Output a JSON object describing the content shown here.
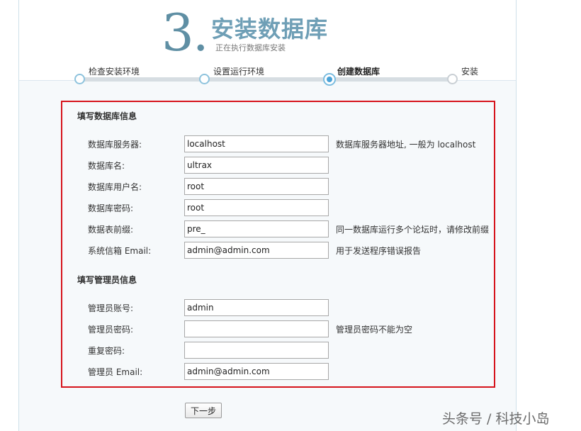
{
  "header": {
    "step_number": "3.",
    "title": "安装数据库",
    "subtitle": "正在执行数据库安装"
  },
  "progress": {
    "steps": [
      {
        "label": "检查安装环境",
        "state": "done"
      },
      {
        "label": "设置运行环境",
        "state": "done"
      },
      {
        "label": "创建数据库",
        "state": "current"
      },
      {
        "label": "安装",
        "state": "todo"
      }
    ]
  },
  "db_section": {
    "title": "填写数据库信息",
    "fields": [
      {
        "label": "数据库服务器:",
        "value": "localhost",
        "hint": "数据库服务器地址, 一般为 localhost"
      },
      {
        "label": "数据库名:",
        "value": "ultrax",
        "hint": ""
      },
      {
        "label": "数据库用户名:",
        "value": "root",
        "hint": ""
      },
      {
        "label": "数据库密码:",
        "value": "root",
        "hint": ""
      },
      {
        "label": "数据表前缀:",
        "value": "pre_",
        "hint": "同一数据库运行多个论坛时，请修改前缀"
      },
      {
        "label": "系统信箱 Email:",
        "value": "admin@admin.com",
        "hint": "用于发送程序错误报告"
      }
    ]
  },
  "admin_section": {
    "title": "填写管理员信息",
    "fields": [
      {
        "label": "管理员账号:",
        "value": "admin",
        "hint": ""
      },
      {
        "label": "管理员密码:",
        "value": "",
        "hint": "管理员密码不能为空"
      },
      {
        "label": "重复密码:",
        "value": "",
        "hint": ""
      },
      {
        "label": "管理员 Email:",
        "value": "admin@admin.com",
        "hint": ""
      }
    ]
  },
  "actions": {
    "next_label": "下一步"
  },
  "watermark": "头条号 / 科技小岛",
  "colors": {
    "highlight_border": "#d6141c",
    "title_blue": "#6f9fb6",
    "progress_active": "#4aa3d8"
  }
}
